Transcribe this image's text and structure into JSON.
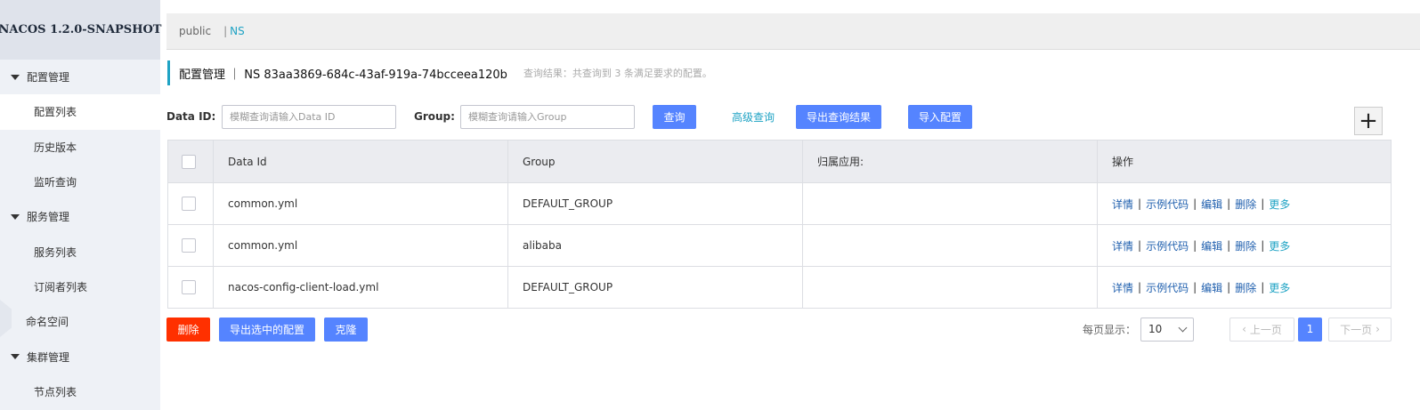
{
  "sidebar": {
    "brand": "NACOS 1.2.0-SNAPSHOT",
    "groups": [
      {
        "label": "配置管理",
        "items": [
          "配置列表",
          "历史版本",
          "监听查询"
        ]
      },
      {
        "label": "服务管理",
        "items": [
          "服务列表",
          "订阅者列表"
        ]
      },
      {
        "label": "命名空间"
      },
      {
        "label": "集群管理",
        "items": [
          "节点列表"
        ]
      }
    ]
  },
  "namespace_bar": {
    "public": "public",
    "separator": "|",
    "current": "NS"
  },
  "title": {
    "text": "配置管理 ｜ NS  83aa3869-684c-43af-919a-74bcceea120b",
    "hint": "查询结果：共查询到 3 条满足要求的配置。"
  },
  "filter": {
    "data_id_label": "Data ID:",
    "data_id_placeholder": "模糊查询请输入Data ID",
    "group_label": "Group:",
    "group_placeholder": "模糊查询请输入Group",
    "query_button": "查询",
    "advanced_query": "高级查询",
    "export_results_button": "导出查询结果",
    "import_button": "导入配置",
    "add_symbol": "+"
  },
  "table": {
    "headers": [
      "Data Id",
      "Group",
      "归属应用:",
      "操作"
    ],
    "rows": [
      {
        "data_id": "common.yml",
        "group": "DEFAULT_GROUP",
        "app": ""
      },
      {
        "data_id": "common.yml",
        "group": "alibaba",
        "app": ""
      },
      {
        "data_id": "nacos-config-client-load.yml",
        "group": "DEFAULT_GROUP",
        "app": ""
      }
    ],
    "ops": {
      "detail": "详情",
      "sample": "示例代码",
      "edit": "编辑",
      "delete": "删除",
      "more": "更多",
      "sep": "|"
    }
  },
  "footer": {
    "delete_button": "删除",
    "export_selected_button": "导出选中的配置",
    "clone_button": "克隆",
    "page_size_label": "每页显示：",
    "page_size_value": "10",
    "prev": "上一页",
    "current_page": "1",
    "next": "下一页"
  },
  "colors": {
    "primary": "#5584ff",
    "danger": "#ff3000",
    "accent": "#1fa3c4"
  }
}
